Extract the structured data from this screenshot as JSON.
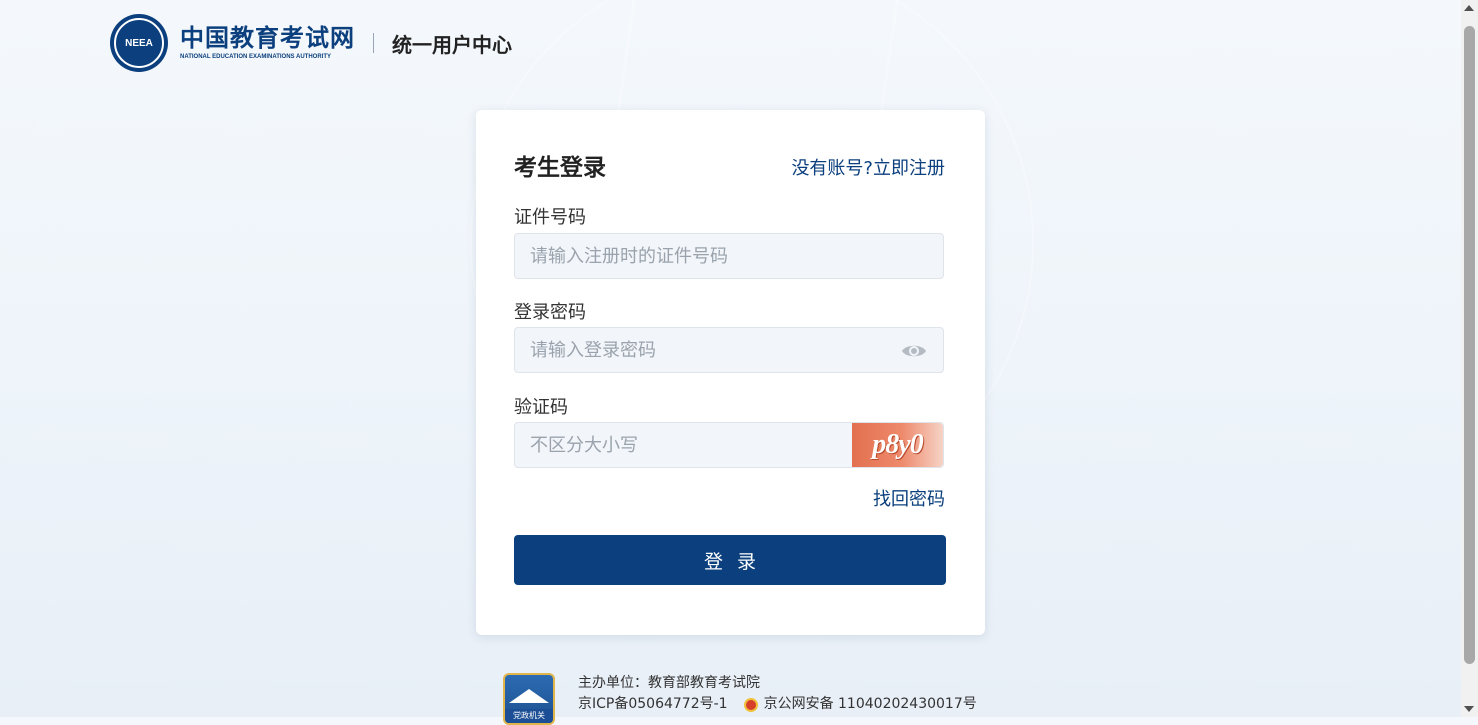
{
  "header": {
    "logo_abbr": "NEEA",
    "logo_cn": "中国教育考试网",
    "logo_en": "NATIONAL EDUCATION EXAMINATIONS AUTHORITY",
    "subtitle": "统一用户中心"
  },
  "login": {
    "title": "考生登录",
    "register_link": "没有账号?立即注册",
    "id_label": "证件号码",
    "id_placeholder": "请输入注册时的证件号码",
    "password_label": "登录密码",
    "password_placeholder": "请输入登录密码",
    "captcha_label": "验证码",
    "captcha_placeholder": "不区分大小写",
    "captcha_text": "p8y0",
    "forgot_link": "找回密码",
    "submit_label": "登录"
  },
  "footer": {
    "badge_label": "党政机关",
    "sponsor": "主办单位：教育部教育考试院",
    "icp": "京ICP备05064772号-1",
    "police_record": "京公网安备 11040202430017号"
  },
  "colors": {
    "brand": "#0b3f7d",
    "captcha_bg": "#e2704f"
  }
}
